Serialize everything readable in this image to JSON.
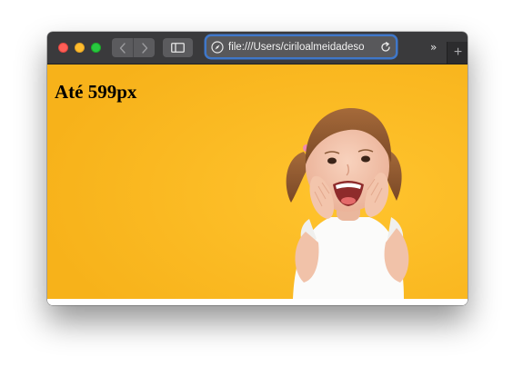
{
  "browser": {
    "url": "file:///Users/ciriloalmeidadeso",
    "overflow_label": "»",
    "newtab_label": "+"
  },
  "page": {
    "heading": "Até 599px",
    "background_color": "#fbb91f",
    "photo_description_icon": "child-photo"
  },
  "colors": {
    "titlebar": "#3a3a3c",
    "urlbar_focus_ring": "#3f77c9",
    "traffic_close": "#fe5f57",
    "traffic_minimize": "#febc2e",
    "traffic_maximize": "#28c840"
  }
}
